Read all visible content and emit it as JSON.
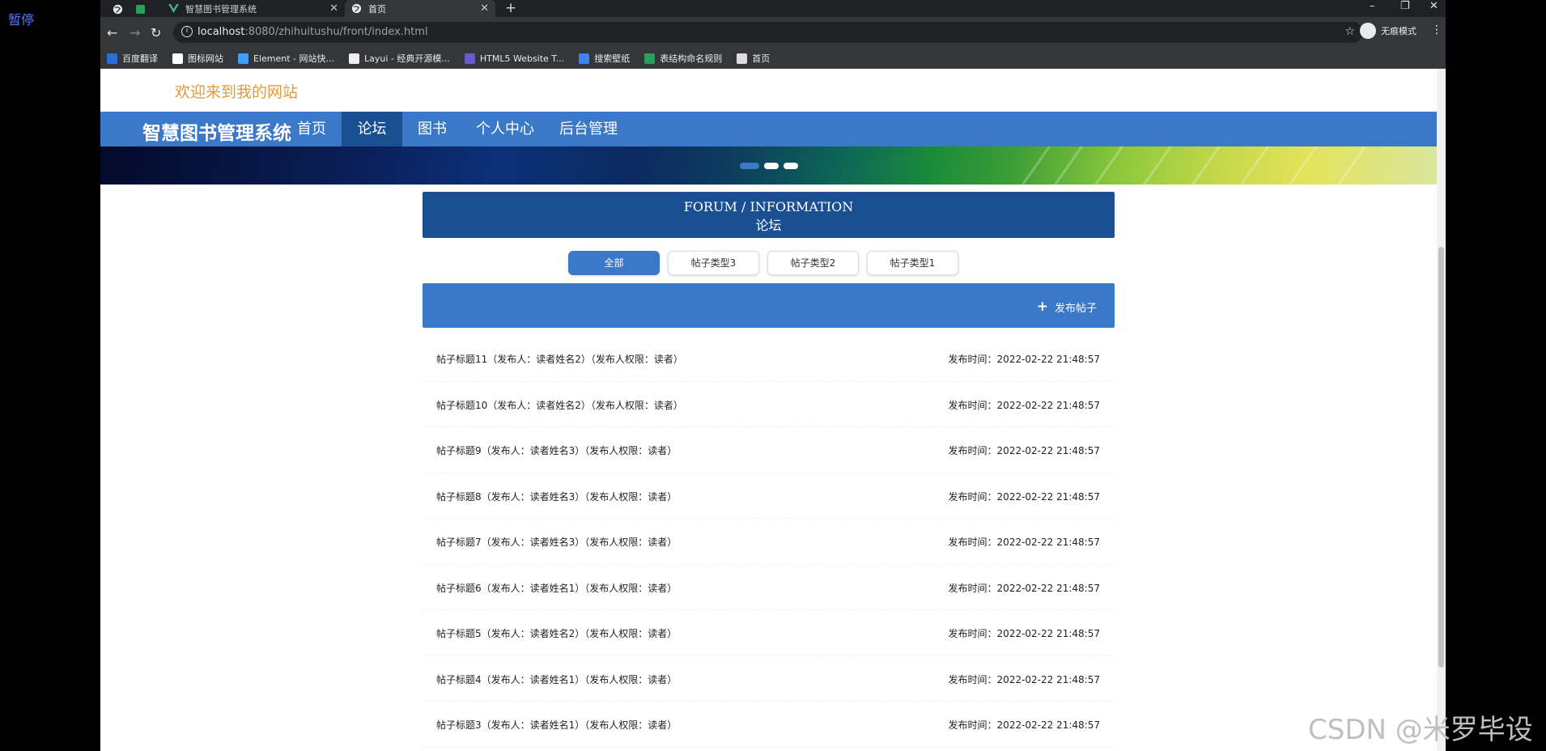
{
  "overlay": {
    "pause_label": "暂停",
    "watermark": "CSDN @米罗毕设"
  },
  "browser": {
    "tabs": [
      {
        "title": "智慧图书管理系统",
        "active": false
      },
      {
        "title": "首页",
        "active": true
      }
    ],
    "new_tab": "+",
    "window_controls": {
      "minimize": "–",
      "restore": "❐",
      "close": "✕"
    },
    "url": {
      "host": "localhost",
      "path": ":8080/zhihuitushu/front/index.html"
    },
    "incognito_label": "无痕模式",
    "bookmarks": [
      {
        "label": "百度翻译",
        "color": "#2b6fd6"
      },
      {
        "label": "图标网站",
        "color": "#ffffff"
      },
      {
        "label": "Element - 网站快...",
        "color": "#409eff"
      },
      {
        "label": "Layui - 经典开源模...",
        "color": "#eeeeee"
      },
      {
        "label": "HTML5 Website T...",
        "color": "#6a5acd"
      },
      {
        "label": "搜索壁纸",
        "color": "#3b82f6"
      },
      {
        "label": "表结构命名规则",
        "color": "#2e9c5a"
      },
      {
        "label": "首页",
        "color": "#dddddd"
      }
    ]
  },
  "site": {
    "welcome": "欢迎来到我的网站",
    "brand": "智慧图书管理系统",
    "nav": [
      {
        "label": "首页",
        "active": false
      },
      {
        "label": "论坛",
        "active": true
      },
      {
        "label": "图书",
        "active": false
      },
      {
        "label": "个人中心",
        "active": false
      },
      {
        "label": "后台管理",
        "active": false
      }
    ],
    "colors": {
      "primary": "#3a78c8",
      "dark": "#1a4f94",
      "welcome": "#e09c3a"
    }
  },
  "forum": {
    "header_en": "FORUM / INFORMATION",
    "header_zh": "论坛",
    "filters": [
      {
        "label": "全部",
        "active": true
      },
      {
        "label": "帖子类型3",
        "active": false
      },
      {
        "label": "帖子类型2",
        "active": false
      },
      {
        "label": "帖子类型1",
        "active": false
      }
    ],
    "post_button": "发布帖子",
    "posts": [
      {
        "title": "帖子标题11（发布人：读者姓名2）（发布人权限：读者）",
        "time": "发布时间：2022-02-22 21:48:57"
      },
      {
        "title": "帖子标题10（发布人：读者姓名2）（发布人权限：读者）",
        "time": "发布时间：2022-02-22 21:48:57"
      },
      {
        "title": "帖子标题9（发布人：读者姓名3）（发布人权限：读者）",
        "time": "发布时间：2022-02-22 21:48:57"
      },
      {
        "title": "帖子标题8（发布人：读者姓名3）（发布人权限：读者）",
        "time": "发布时间：2022-02-22 21:48:57"
      },
      {
        "title": "帖子标题7（发布人：读者姓名3）（发布人权限：读者）",
        "time": "发布时间：2022-02-22 21:48:57"
      },
      {
        "title": "帖子标题6（发布人：读者姓名1）（发布人权限：读者）",
        "time": "发布时间：2022-02-22 21:48:57"
      },
      {
        "title": "帖子标题5（发布人：读者姓名2）（发布人权限：读者）",
        "time": "发布时间：2022-02-22 21:48:57"
      },
      {
        "title": "帖子标题4（发布人：读者姓名1）（发布人权限：读者）",
        "time": "发布时间：2022-02-22 21:48:57"
      },
      {
        "title": "帖子标题3（发布人：读者姓名1）（发布人权限：读者）",
        "time": "发布时间：2022-02-22 21:48:57"
      }
    ]
  }
}
